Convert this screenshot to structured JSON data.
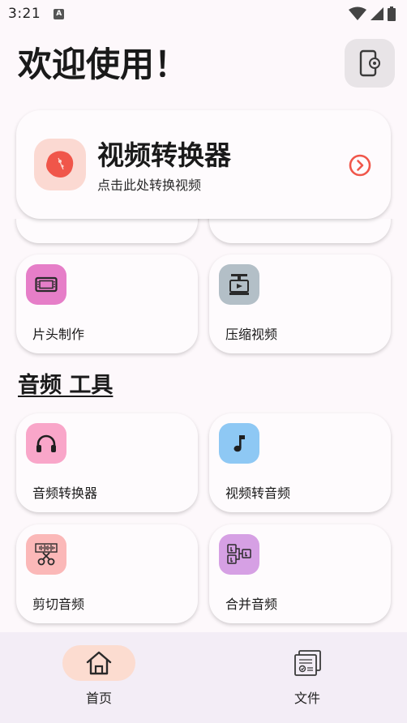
{
  "status": {
    "time": "3:21",
    "notification_glyph": "A"
  },
  "header": {
    "title": "欢迎使用！"
  },
  "hero": {
    "title": "视频转换器",
    "subtitle": "点击此处转换视频",
    "icon_color": "#f0564a",
    "icon_bg": "#fbd9d2"
  },
  "video_tools": [
    {
      "label": "片头制作",
      "icon": "film-strip-icon",
      "icon_bg": "#e67ec8"
    },
    {
      "label": "压缩视频",
      "icon": "video-compress-icon",
      "icon_bg": "#b3bfc7"
    }
  ],
  "audio_section": {
    "title": "音频 工具"
  },
  "audio_tools": [
    {
      "label": "音频转换器",
      "icon": "headphones-icon",
      "icon_bg": "#f9a6c9"
    },
    {
      "label": "视频转音频",
      "icon": "music-note-icon",
      "icon_bg": "#8ec8f4"
    },
    {
      "label": "剪切音频",
      "icon": "scissors-waveform-icon",
      "icon_bg": "#fbb8b8"
    },
    {
      "label": "合并音频",
      "icon": "merge-audio-icon",
      "icon_bg": "#d6a0e4"
    }
  ],
  "bottom_nav": [
    {
      "label": "首页",
      "icon": "home-icon",
      "active": true
    },
    {
      "label": "文件",
      "icon": "files-icon",
      "active": false
    }
  ],
  "colors": {
    "accent": "#f0564a",
    "nav_active_pill": "#fcdcd0",
    "nav_bg": "#f3edf6",
    "background": "#fdf8fb"
  }
}
